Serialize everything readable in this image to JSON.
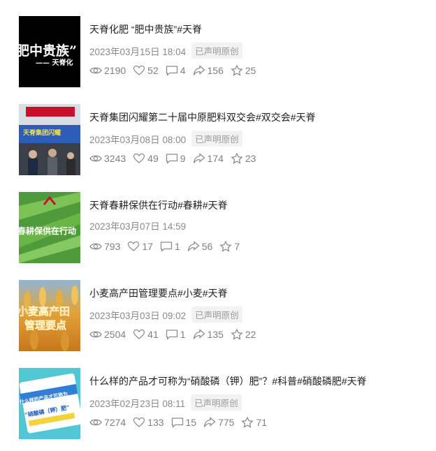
{
  "posts": [
    {
      "title": "天脊化肥 “肥中贵族”#天脊",
      "date": "2023年03月15日 18:04",
      "badge": "已声明原创",
      "views": "2190",
      "likes": "52",
      "comments": "4",
      "shares": "156",
      "favorites": "25",
      "thumb_text": "肥中贵族”",
      "thumb_sub": "—— 天脊化"
    },
    {
      "title": "天脊集团闪耀第二十届中原肥料双交会#双交会#天脊",
      "date": "2023年03月08日 08:00",
      "badge": "已声明原创",
      "views": "3243",
      "likes": "49",
      "comments": "9",
      "shares": "174",
      "favorites": "23",
      "thumb_text": "天脊集团闪耀"
    },
    {
      "title": "天脊春耕保供在行动#春耕#天脊",
      "date": "2023年03月07日 14:59",
      "badge": "",
      "views": "793",
      "likes": "17",
      "comments": "1",
      "shares": "56",
      "favorites": "7",
      "thumb_text": "春耕保供在行动"
    },
    {
      "title": "小麦高产田管理要点#小麦#天脊",
      "date": "2023年03月03日 09:02",
      "badge": "已声明原创",
      "views": "2504",
      "likes": "41",
      "comments": "1",
      "shares": "135",
      "favorites": "22",
      "thumb_text": "小麦高产田",
      "thumb_sub": "管理要点"
    },
    {
      "title": "什么样的产品才可称为“硝酸磷（钾）肥”？#科普#硝酸磷肥#天脊",
      "date": "2023年02月23日 08:11",
      "badge": "已声明原创",
      "views": "7274",
      "likes": "133",
      "comments": "15",
      "shares": "775",
      "favorites": "71",
      "thumb_text": "什么样的产品才可称为",
      "thumb_sub": "“硝酸磷（钾）肥”"
    }
  ]
}
